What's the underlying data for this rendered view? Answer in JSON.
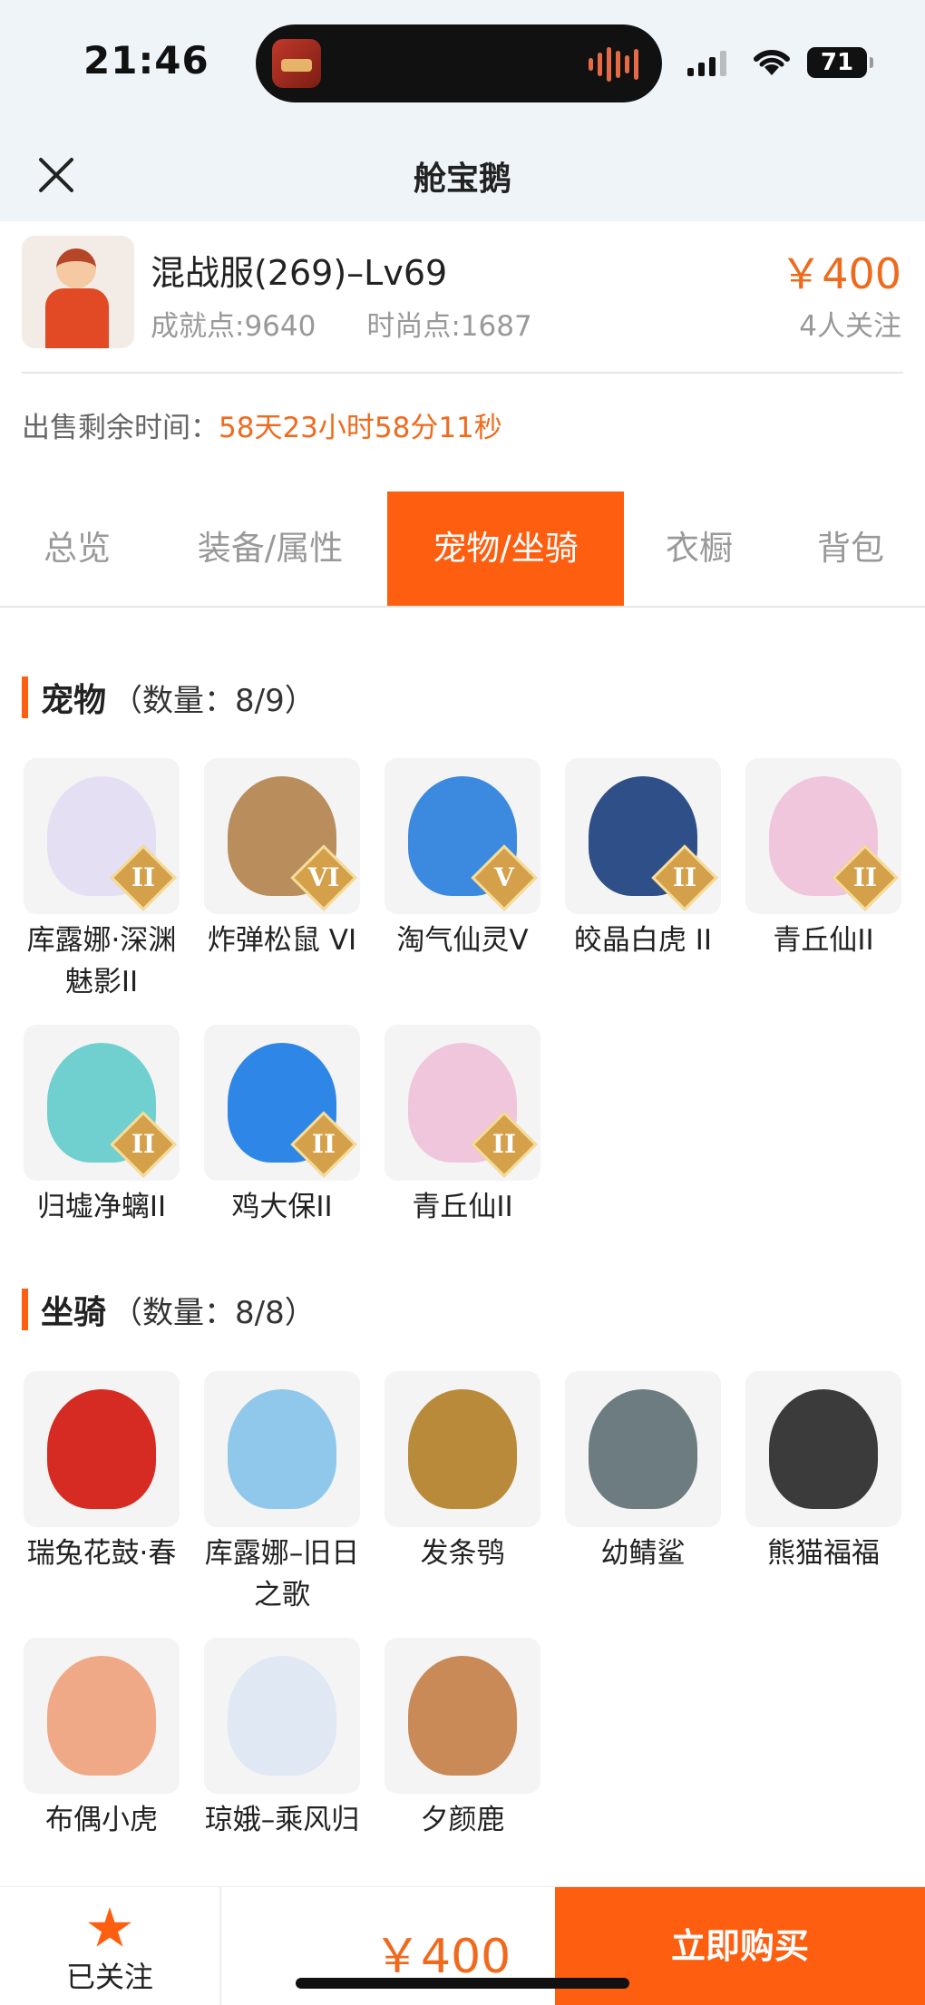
{
  "status_bar": {
    "time": "21:46",
    "battery": "71"
  },
  "nav": {
    "title": "舱宝鹅"
  },
  "listing": {
    "server_level": "混战服(269)–Lv69",
    "achievement": "成就点:9640",
    "fashion": "时尚点:1687",
    "price": "￥400",
    "followers": "4人关注",
    "remain_label": "出售剩余时间：",
    "remain_time": "58天23小时58分11秒"
  },
  "tabs": [
    {
      "label": "总览",
      "active": false
    },
    {
      "label": "装备/属性",
      "active": false
    },
    {
      "label": "宠物/坐骑",
      "active": true
    },
    {
      "label": "衣橱",
      "active": false
    },
    {
      "label": "背包",
      "active": false
    }
  ],
  "pets": {
    "title": "宠物",
    "count": "（数量：8/9）",
    "items": [
      {
        "name": "库露娜·深渊魅影II",
        "badge": "II",
        "color": "#e4dff3"
      },
      {
        "name": "炸弹松鼠 VI",
        "badge": "VI",
        "color": "#b98d5c"
      },
      {
        "name": "淘气仙灵V",
        "badge": "V",
        "color": "#3b8ae0"
      },
      {
        "name": "皎晶白虎 II",
        "badge": "II",
        "color": "#2f4f88"
      },
      {
        "name": "青丘仙II",
        "badge": "II",
        "color": "#efc6dc"
      },
      {
        "name": "归墟净螭II",
        "badge": "II",
        "color": "#6fd0cf"
      },
      {
        "name": "鸡大保II",
        "badge": "II",
        "color": "#2e86e6"
      },
      {
        "name": "青丘仙II",
        "badge": "II",
        "color": "#efc6dc"
      }
    ]
  },
  "mounts": {
    "title": "坐骑",
    "count": "（数量：8/8）",
    "items": [
      {
        "name": "瑞兔花鼓·春",
        "color": "#d62b23"
      },
      {
        "name": "库露娜–旧日之歌",
        "color": "#8fc8ea"
      },
      {
        "name": "发条鸮",
        "color": "#b88a3a"
      },
      {
        "name": "幼鲭鲨",
        "color": "#6c7c80"
      },
      {
        "name": "熊猫福福",
        "color": "#3b3b3b"
      },
      {
        "name": "布偶小虎",
        "color": "#f0a986"
      },
      {
        "name": "琼娥–乘风归",
        "color": "#dfe8f3"
      },
      {
        "name": "夕颜鹿",
        "color": "#c98a58"
      }
    ]
  },
  "bottom_bar": {
    "follow_label": "已关注",
    "price": "￥400",
    "buy_label": "立即购买"
  },
  "accent_color": "#fe5e10",
  "price_color": "#f06a1d"
}
